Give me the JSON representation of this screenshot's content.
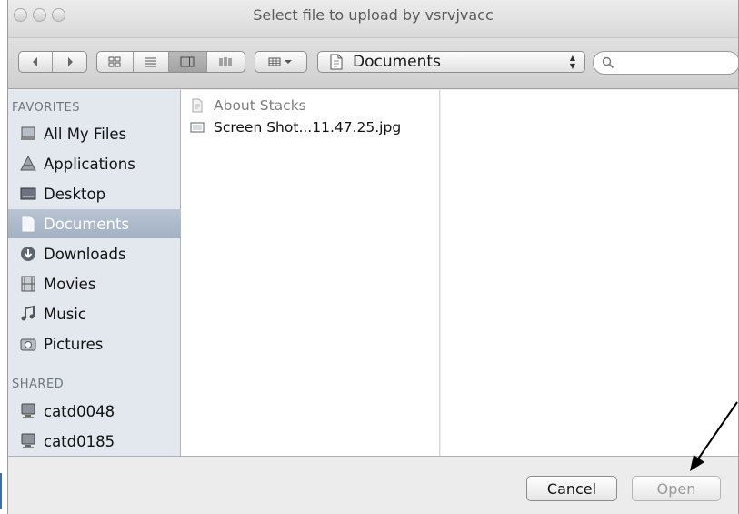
{
  "window": {
    "title": "Select file to upload by vsrvjvacc"
  },
  "toolbar": {
    "location": "Documents",
    "search_placeholder": ""
  },
  "sidebar": {
    "favorites_header": "FAVORITES",
    "favorites": [
      {
        "label": "All My Files",
        "icon": "all-files-icon"
      },
      {
        "label": "Applications",
        "icon": "applications-icon"
      },
      {
        "label": "Desktop",
        "icon": "desktop-icon"
      },
      {
        "label": "Documents",
        "icon": "documents-icon",
        "selected": true
      },
      {
        "label": "Downloads",
        "icon": "downloads-icon"
      },
      {
        "label": "Movies",
        "icon": "movies-icon"
      },
      {
        "label": "Music",
        "icon": "music-icon"
      },
      {
        "label": "Pictures",
        "icon": "pictures-icon"
      }
    ],
    "shared_header": "SHARED",
    "shared": [
      {
        "label": "catd0048",
        "icon": "computer-icon"
      },
      {
        "label": "catd0185",
        "icon": "computer-icon"
      }
    ]
  },
  "files": [
    {
      "name": "About Stacks",
      "disabled": true,
      "icon": "document-icon"
    },
    {
      "name": "Screen Shot...11.47.25.jpg",
      "disabled": false,
      "icon": "image-file-icon"
    }
  ],
  "footer": {
    "cancel_label": "Cancel",
    "open_label": "Open"
  },
  "colors": {
    "sidebar_bg": "#e3e8ef",
    "selection": "#a9b6c8"
  }
}
